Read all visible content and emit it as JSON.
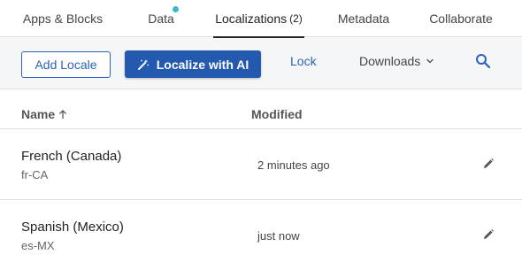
{
  "tabs": [
    {
      "label": "Apps & Blocks",
      "count": ""
    },
    {
      "label": "Data",
      "count": ""
    },
    {
      "label": "Localizations",
      "count": "(2)"
    },
    {
      "label": "Metadata",
      "count": ""
    },
    {
      "label": "Collaborate",
      "count": ""
    }
  ],
  "active_tab": "Localizations",
  "toolbar": {
    "add_locale_label": "Add Locale",
    "localize_ai_label": "Localize with AI",
    "lock_label": "Lock",
    "downloads_label": "Downloads"
  },
  "table": {
    "columns": [
      {
        "label": "Name",
        "sorted": "ascending"
      },
      {
        "label": "Modified"
      }
    ],
    "rows": [
      {
        "name": "French (Canada)",
        "code": "fr-CA",
        "modified": "2 minutes ago"
      },
      {
        "name": "Spanish (Mexico)",
        "code": "es-MX",
        "modified": "just now"
      }
    ]
  },
  "icons": {
    "data_status_dot": "notification-dot",
    "localize": "magic-wand-icon",
    "downloads": "chevron-down-icon",
    "search": "search-icon",
    "sort": "arrow-up-icon",
    "row_action": "pencil-icon"
  },
  "colors": {
    "accent": "#2d63b8",
    "primary_button": "#2459b0",
    "notification_dot": "#3ab7c9",
    "toolbar_bg": "#f5f6f7"
  }
}
